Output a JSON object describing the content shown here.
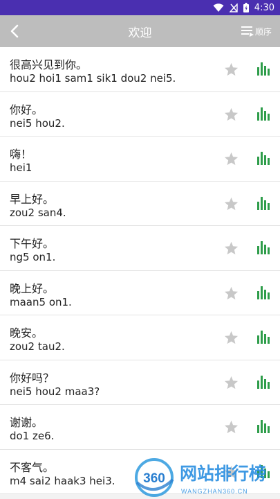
{
  "status_bar": {
    "time": "4:30"
  },
  "app_bar": {
    "title": "欢迎",
    "order_label": "顺序"
  },
  "phrases": [
    {
      "chinese": "很高兴见到你。",
      "jyutping": "hou2 hoi1 sam1 sik1 dou2 nei5."
    },
    {
      "chinese": "你好。",
      "jyutping": "nei5 hou2."
    },
    {
      "chinese": "嗨！",
      "jyutping": "hei1"
    },
    {
      "chinese": "早上好。",
      "jyutping": "zou2 san4."
    },
    {
      "chinese": "下午好。",
      "jyutping": "ng5 on1."
    },
    {
      "chinese": "晚上好。",
      "jyutping": "maan5 on1."
    },
    {
      "chinese": "晚安。",
      "jyutping": "zou2 tau2."
    },
    {
      "chinese": "你好吗？",
      "jyutping": "nei5 hou2 maa3?"
    },
    {
      "chinese": "谢谢。",
      "jyutping": "do1 ze6."
    },
    {
      "chinese": "不客气。",
      "jyutping": "m4 sai2 haak3 hei3."
    }
  ],
  "watermark": {
    "logo_text": "360",
    "site_name": "网站排行榜",
    "site_url": "WANGZHAN360.CN"
  },
  "colors": {
    "status_bar": "#4a2fb0",
    "app_bar": "#bdbdbd",
    "accent_green": "#2e9d4a",
    "star_gray": "#c8c8c8"
  }
}
